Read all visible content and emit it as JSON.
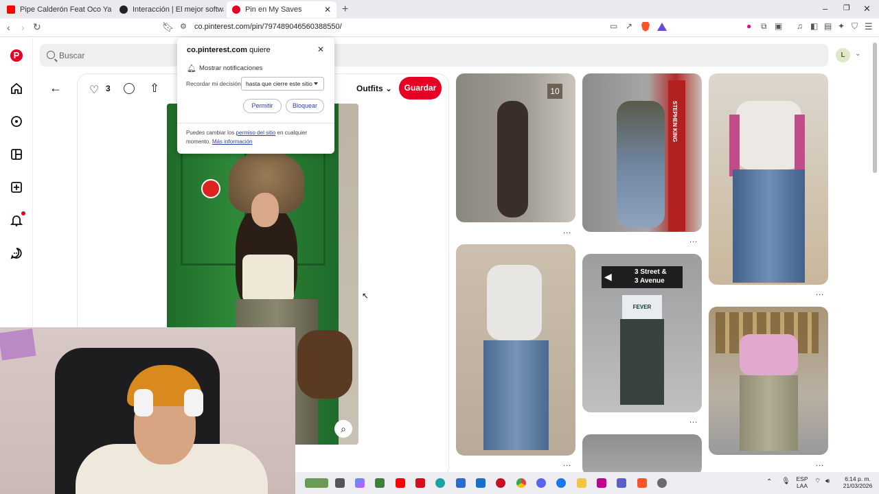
{
  "browser": {
    "tabs": [
      {
        "title": "Pipe Calderón Feat Oco Yajé - De Re",
        "favicon_color": "#ff0000"
      },
      {
        "title": "Interacción | El mejor software p",
        "favicon_color": "#222222"
      },
      {
        "title": "Pin en My Saves",
        "favicon_color": "#e60023"
      }
    ],
    "url": "co.pinterest.com/pin/797489046560388550/"
  },
  "pinterest": {
    "search_placeholder": "Buscar",
    "avatar_letter": "L",
    "like_count": "3",
    "board_name": "Outfits",
    "save_label": "Guardar",
    "accent": "#e60023"
  },
  "permission_popup": {
    "site": "co.pinterest.com",
    "site_suffix": "quiere",
    "notification_label": "Mostrar notificaciones",
    "remember_label": "Recordar mi decisión",
    "remember_value": "hasta que cierre este sitio",
    "allow_label": "Permitir",
    "block_label": "Bloquear",
    "footer_pre": "Puedes cambiar los",
    "footer_link": "permiso del sitio",
    "footer_mid": "en cualquier momento.",
    "footer_more": "Más información"
  },
  "grid": {
    "overflow_label": "...",
    "street_sign_line1": "3 Street &",
    "street_sign_line2": "3 Avenue",
    "poster_text": "STEPHEN KING",
    "jersey_text": "FEVER",
    "door_number": "10"
  },
  "taskbar": {
    "lang_line1": "ESP",
    "lang_line2": "LAA",
    "time": "6:14 p. m.",
    "date": "21/03/2026"
  }
}
